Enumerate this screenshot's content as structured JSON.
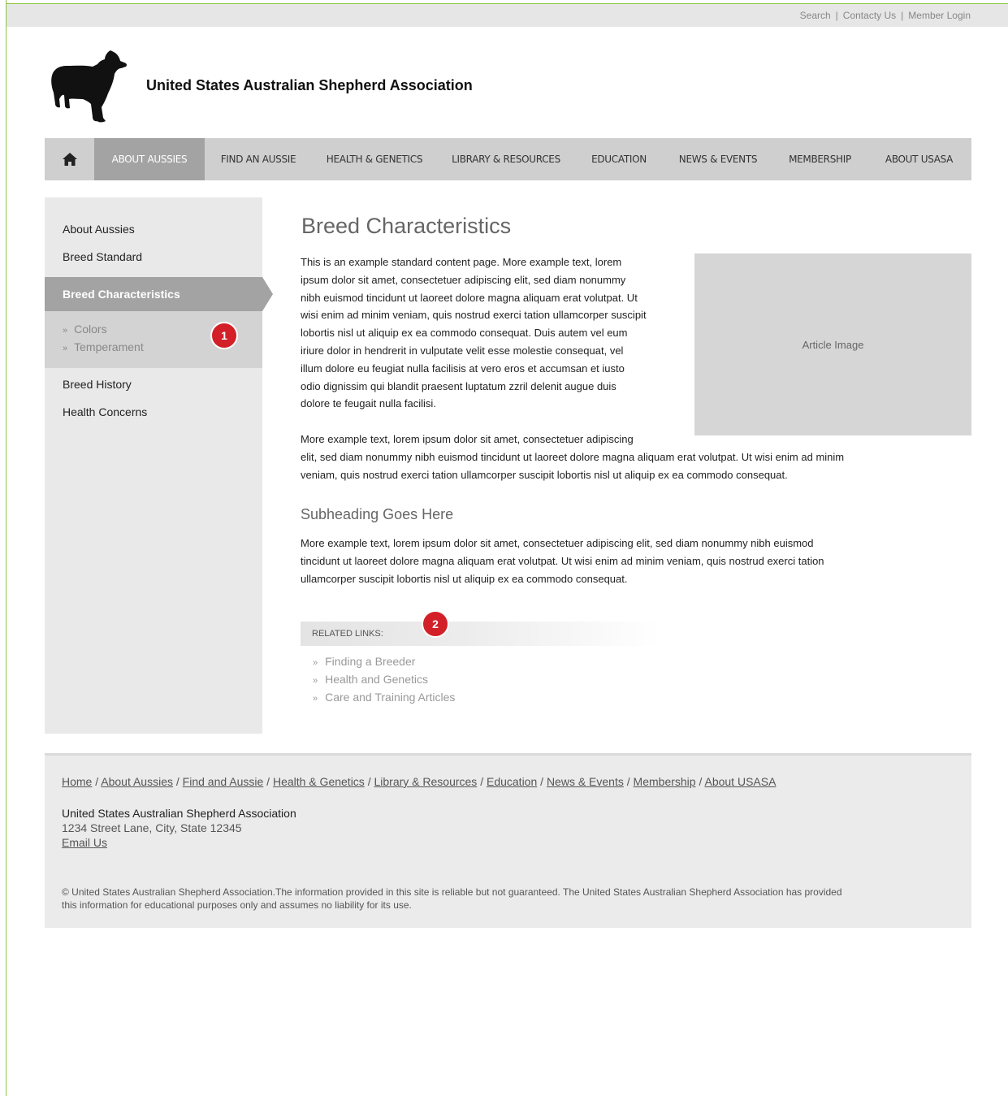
{
  "utility": {
    "links": [
      "Search",
      "Contacty Us",
      "Member Login"
    ],
    "separator": "|"
  },
  "header": {
    "site_title": "United States Australian Shepherd Association",
    "logo_icon": "dog-silhouette-icon"
  },
  "nav": {
    "home_icon": "home-icon",
    "items": [
      {
        "label": "ABOUT AUSSIES",
        "active": true
      },
      {
        "label": "FIND AN AUSSIE",
        "active": false
      },
      {
        "label": "HEALTH & GENETICS",
        "active": false
      },
      {
        "label": "LIBRARY & RESOURCES",
        "active": false
      },
      {
        "label": "EDUCATION",
        "active": false
      },
      {
        "label": "NEWS & EVENTS",
        "active": false
      },
      {
        "label": "MEMBERSHIP",
        "active": false
      },
      {
        "label": "ABOUT USASA",
        "active": false
      }
    ]
  },
  "sidebar": {
    "items": [
      "About Aussies",
      "Breed Standard"
    ],
    "active": "Breed Characteristics",
    "sub_bullet": "»",
    "sub_items": [
      "Colors",
      "Temperament"
    ],
    "items_after": [
      "Breed History",
      "Health Concerns"
    ]
  },
  "annotations": [
    "1",
    "2"
  ],
  "main": {
    "title": "Breed Characteristics",
    "para1_lines": [
      "This is an example standard content page. More example text, lorem",
      "ipsum dolor sit amet, consectetuer adipiscing elit, sed diam nonummy",
      "nibh euismod tincidunt ut laoreet dolore magna aliquam erat volutpat. Ut",
      "wisi enim ad minim veniam, quis nostrud exerci tation ullamcorper suscipit",
      "lobortis nisl ut aliquip ex ea commodo consequat. Duis autem vel eum",
      "iriure dolor in hendrerit in vulputate velit esse molestie consequat, vel",
      "illum dolore eu feugiat nulla facilisis at vero eros et accumsan et iusto",
      "odio dignissim qui blandit praesent luptatum zzril delenit augue duis",
      "dolore te feugait nulla facilisi."
    ],
    "image_label": "Article Image",
    "para2_lines": [
      "More example text, lorem ipsum dolor sit amet, consectetuer adipiscing",
      "elit, sed diam nonummy nibh euismod tincidunt ut laoreet dolore magna aliquam erat volutpat. Ut wisi enim ad minim",
      "veniam, quis nostrud exerci tation ullamcorper suscipit lobortis nisl ut aliquip ex ea commodo consequat."
    ],
    "subheading": "Subheading Goes Here",
    "para3_lines": [
      "More example text, lorem ipsum dolor sit amet, consectetuer adipiscing elit, sed diam nonummy nibh euismod",
      "tincidunt ut laoreet dolore magna aliquam erat volutpat. Ut wisi enim ad minim veniam, quis nostrud exerci tation",
      "ullamcorper suscipit lobortis nisl ut aliquip ex ea commodo consequat."
    ],
    "related": {
      "title": "RELATED LINKS:",
      "bullet": "»",
      "links": [
        "Finding a Breeder",
        "Health and Genetics",
        "Care and Training Articles"
      ]
    }
  },
  "footer": {
    "nav_links": [
      "Home",
      "About Aussies",
      "Find and Aussie",
      "Health & Genetics",
      "Library & Resources",
      "Education",
      "News & Events",
      "Membership",
      "About USASA"
    ],
    "nav_separator": " / ",
    "org_name": "United States Australian Shepherd Association",
    "address": "1234 Street Lane, City, State 12345",
    "email_label": "Email Us",
    "copyright_lines": [
      "© United States Australian Shepherd Association.The information provided in this site is reliable but not guaranteed. The United States Australian Shepherd Association has provided",
      "this information for educational purposes only and assumes no liability for its use."
    ]
  },
  "colors": {
    "accent_red": "#d32028",
    "nav_bg": "#cfcfcf",
    "nav_active": "#a3a3a3",
    "frame_green": "#8cc63f"
  }
}
